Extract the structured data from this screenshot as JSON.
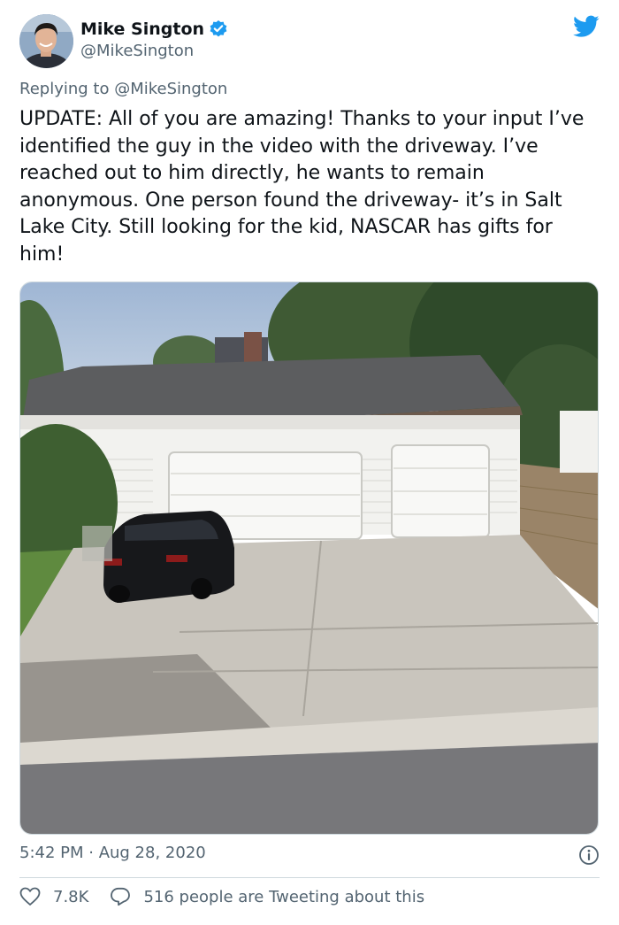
{
  "author": {
    "display_name": "Mike Sington",
    "handle": "@MikeSington",
    "verified": true,
    "avatar_icon": "profile-photo"
  },
  "brand": {
    "icon": "twitter-bird-icon",
    "color": "#1d9bf0"
  },
  "reply": {
    "prefix": "Replying to ",
    "mention": "@MikeSington"
  },
  "tweet": {
    "text": "UPDATE: All of you are amazing! Thanks to your input I’ve identified the guy in the video with the driveway. I’ve reached out to him directly, he wants to remain anonymous. One person found the driveway- it’s in Salt Lake City. Still looking for the kid, NASCAR has gifts for him!",
    "media": "photo of a house with a three-car garage and a black car in the driveway",
    "timestamp": "5:42 PM · Aug 28, 2020"
  },
  "stats": {
    "likes": "7.8K",
    "tweeting": "516 people are Tweeting about this"
  }
}
